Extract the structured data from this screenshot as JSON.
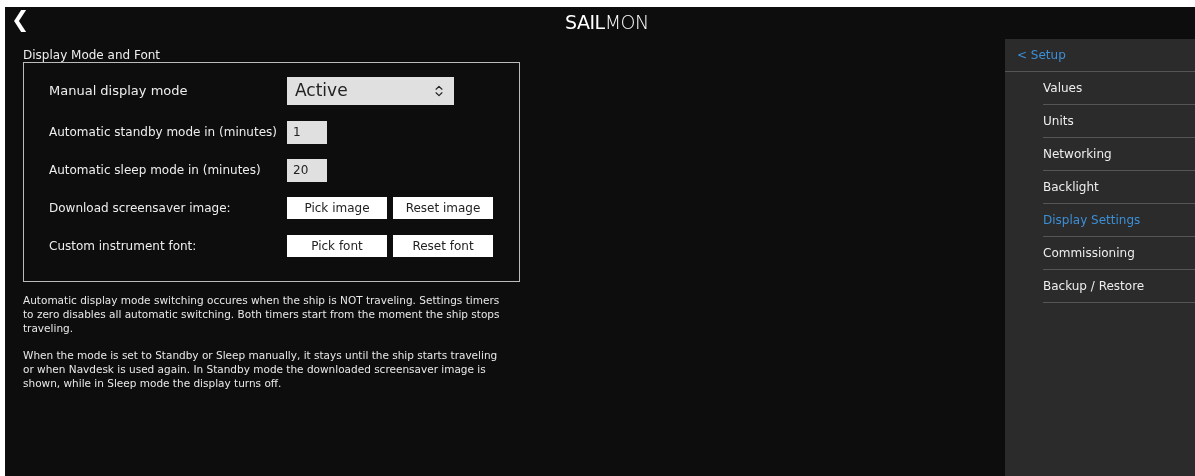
{
  "header": {
    "back": "❮",
    "logo": "**SAIL**MON"
  },
  "section": {
    "title": "Display Mode and Font",
    "rows": [
      {
        "kind": "select",
        "label": "Manual display mode",
        "value": "Active"
      },
      {
        "kind": "number",
        "label": "Automatic standby mode in (minutes)",
        "value": "1"
      },
      {
        "kind": "number",
        "label": "Automatic sleep mode in (minutes)",
        "value": "20"
      },
      {
        "kind": "buttons",
        "label": "Download screensaver image:",
        "buttons": [
          "Pick image",
          "Reset image"
        ]
      },
      {
        "kind": "buttons",
        "label": "Custom instrument font:",
        "buttons": [
          "Pick font",
          "Reset font"
        ]
      }
    ]
  },
  "notes": [
    "Automatic display mode switching occures when the ship is NOT traveling. Settings timers to zero disables all automatic switching. Both timers start from the moment the ship stops traveling.",
    "When the mode is set to Standby or Sleep manually, it stays until the ship starts traveling or when Navdesk is used again. In Standby mode the downloaded screensaver image is shown, while in Sleep mode the display turns off."
  ],
  "sidebar": {
    "back": "< Setup",
    "items": [
      {
        "label": "Values",
        "selected": false
      },
      {
        "label": "Units",
        "selected": false
      },
      {
        "label": "Networking",
        "selected": false
      },
      {
        "label": "Backlight",
        "selected": false
      },
      {
        "label": "Display Settings",
        "selected": true
      },
      {
        "label": "Commissioning",
        "selected": false
      },
      {
        "label": "Backup / Restore",
        "selected": false
      }
    ]
  }
}
